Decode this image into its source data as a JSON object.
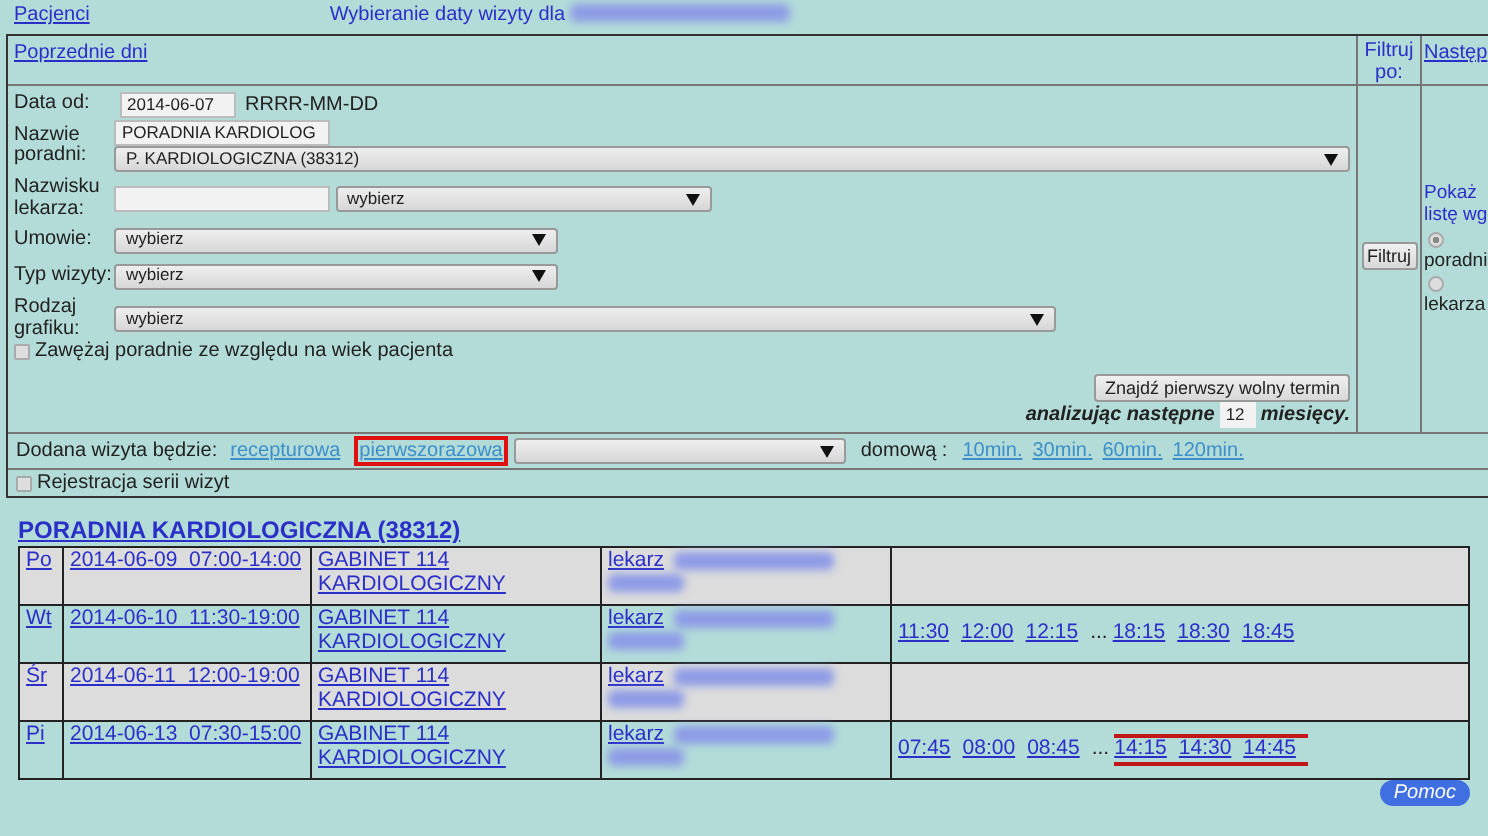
{
  "header": {
    "patients_link": "Pacjenci",
    "title": "Wybieranie daty wizyty dla"
  },
  "form": {
    "previous_days": "Poprzednie dni",
    "filter_by_label": "Filtruj po:",
    "next_link": "Następ",
    "date_from": {
      "label": "Data od:",
      "value": "2014-06-07",
      "format_hint": "RRRR-MM-DD"
    },
    "clinic": {
      "label": "Nazwie poradni:",
      "search_value": "PORADNIA KARDIOLOG",
      "selected": "P. KARDIOLOGICZNA (38312)"
    },
    "doctor": {
      "label": "Nazwisku lekarza:",
      "selected": "wybierz"
    },
    "contract": {
      "label": "Umowie:",
      "selected": "wybierz"
    },
    "visit_type": {
      "label": "Typ wizyty:",
      "selected": "wybierz"
    },
    "schedule_type": {
      "label": "Rodzaj grafiku:",
      "selected": "wybierz"
    },
    "age_filter": {
      "label": "Zawężaj poradnie ze względu na wiek pacjenta",
      "checked": false
    },
    "find_button": "Znajdź pierwszy wolny termin",
    "analyze": {
      "prefix": "analizując następne",
      "months": "12",
      "suffix": "miesięcy."
    },
    "filter_button": "Filtruj",
    "list_by": {
      "label": "Pokaż listę wg",
      "options": [
        {
          "label": "poradni",
          "selected": true
        },
        {
          "label": "lekarza",
          "selected": false
        }
      ]
    },
    "visit_mode": {
      "label": "Dodana wizyta będzie:",
      "options": [
        {
          "label": "recepturowa",
          "highlighted": false
        },
        {
          "label": "pierwszorazowa",
          "highlighted": true
        }
      ],
      "home_label": "domową :",
      "home_options": [
        "10min.",
        "30min.",
        "60min.",
        "120min."
      ]
    },
    "series": {
      "label": "Rejestracja serii wizyt",
      "checked": false
    }
  },
  "clinic_heading": "PORADNIA KARDIOLOGICZNA (38312)",
  "rows": [
    {
      "day": "Po",
      "date_time": "2014-06-09  07:00-14:00",
      "room": "GABINET 114 KARDIOLOGICZNY",
      "doctor": "lekarz",
      "slots": []
    },
    {
      "day": "Wt",
      "date_time": "2014-06-10  11:30-19:00",
      "room": "GABINET 114 KARDIOLOGICZNY",
      "doctor": "lekarz",
      "slots": [
        {
          "kind": "slot",
          "text": "11:30",
          "highlighted": false
        },
        {
          "kind": "slot",
          "text": "12:00",
          "highlighted": false
        },
        {
          "kind": "slot",
          "text": "12:15",
          "highlighted": false
        },
        {
          "kind": "gap",
          "text": "..."
        },
        {
          "kind": "slot",
          "text": "18:15",
          "highlighted": false
        },
        {
          "kind": "slot",
          "text": "18:30",
          "highlighted": false
        },
        {
          "kind": "slot",
          "text": "18:45",
          "highlighted": false
        }
      ]
    },
    {
      "day": "Śr",
      "date_time": "2014-06-11  12:00-19:00",
      "room": "GABINET 114 KARDIOLOGICZNY",
      "doctor": "lekarz",
      "slots": []
    },
    {
      "day": "Pi",
      "date_time": "2014-06-13  07:30-15:00",
      "room": "GABINET 114 KARDIOLOGICZNY",
      "doctor": "lekarz",
      "slots": [
        {
          "kind": "slot",
          "text": "07:45",
          "highlighted": false
        },
        {
          "kind": "slot",
          "text": "08:00",
          "highlighted": false
        },
        {
          "kind": "slot",
          "text": "08:45",
          "highlighted": false
        },
        {
          "kind": "gap",
          "text": "..."
        },
        {
          "kind": "slot",
          "text": "14:15",
          "highlighted": true
        },
        {
          "kind": "slot",
          "text": "14:30",
          "highlighted": true
        },
        {
          "kind": "slot",
          "text": "14:45",
          "highlighted": true
        }
      ]
    }
  ],
  "help_button": "Pomoc"
}
